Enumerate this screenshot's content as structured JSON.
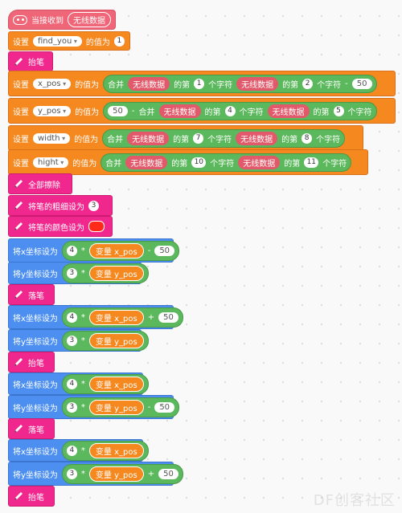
{
  "hat": {
    "label": "当接收到",
    "message": "无线数据"
  },
  "set_find": {
    "set": "设置",
    "var": "find_you",
    "to": "的值为",
    "value": "1"
  },
  "pen_up_1": {
    "label": "抬笔"
  },
  "set_xpos": {
    "set": "设置",
    "var": "x_pos",
    "to": "的值为",
    "join": "合并",
    "s1": "无线数据",
    "of1": "的第",
    "n1": "1",
    "c1": "个字符",
    "s2": "无线数据",
    "of2": "的第",
    "n2": "2",
    "c2": "个字符",
    "minus": "-",
    "v": "50"
  },
  "set_ypos": {
    "set": "设置",
    "var": "y_pos",
    "to": "的值为",
    "v": "50",
    "minus": "-",
    "join": "合并",
    "s1": "无线数据",
    "of1": "的第",
    "n1": "4",
    "c1": "个字符",
    "s2": "无线数据",
    "of2": "的第",
    "n2": "5",
    "c2": "个字符"
  },
  "set_width": {
    "set": "设置",
    "var": "width",
    "to": "的值为",
    "join": "合并",
    "s1": "无线数据",
    "of1": "的第",
    "n1": "7",
    "c1": "个字符",
    "s2": "无线数据",
    "of2": "的第",
    "n2": "8",
    "c2": "个字符"
  },
  "set_hight": {
    "set": "设置",
    "var": "hight",
    "to": "的值为",
    "join": "合并",
    "s1": "无线数据",
    "of1": "的第",
    "n1": "10",
    "c1": "个字符",
    "s2": "无线数据",
    "of2": "的第",
    "n2": "11",
    "c2": "个字符"
  },
  "clear": {
    "label": "全部擦除"
  },
  "pen_size": {
    "label": "将笔的粗细设为",
    "value": "3"
  },
  "pen_color": {
    "label": "将笔的颜色设为",
    "color": "#ff2a1a"
  },
  "setx_1": {
    "label": "将x坐标设为",
    "a": "4",
    "mul": "*",
    "var": "变量 x_pos",
    "op": "-",
    "b": "50"
  },
  "sety_1": {
    "label": "将y坐标设为",
    "a": "3",
    "mul": "*",
    "var": "变量 y_pos"
  },
  "pen_down_1": {
    "label": "落笔"
  },
  "setx_2": {
    "label": "将x坐标设为",
    "a": "4",
    "mul": "*",
    "var": "变量 x_pos",
    "op": "+",
    "b": "50"
  },
  "sety_2": {
    "label": "将y坐标设为",
    "a": "3",
    "mul": "*",
    "var": "变量 y_pos"
  },
  "pen_up_2": {
    "label": "抬笔"
  },
  "setx_3": {
    "label": "将x坐标设为",
    "a": "4",
    "mul": "*",
    "var": "变量 x_pos"
  },
  "sety_3": {
    "label": "将y坐标设为",
    "a": "3",
    "mul": "*",
    "var": "变量 y_pos",
    "op": "-",
    "b": "50"
  },
  "pen_down_2": {
    "label": "落笔"
  },
  "setx_4": {
    "label": "将x坐标设为",
    "a": "4",
    "mul": "*",
    "var": "变量 x_pos"
  },
  "sety_4": {
    "label": "将y坐标设为",
    "a": "3",
    "mul": "*",
    "var": "变量 y_pos",
    "op": "+",
    "b": "50"
  },
  "pen_up_3": {
    "label": "抬笔"
  },
  "watermark": "DF创客社区"
}
